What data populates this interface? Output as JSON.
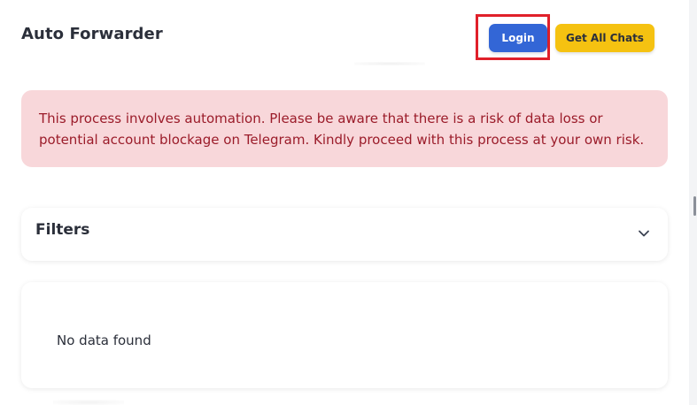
{
  "header": {
    "title": "Auto Forwarder",
    "login_label": "Login",
    "get_chats_label": "Get All Chats"
  },
  "alert": {
    "text": "This process involves automation. Please be aware that there is a risk of data loss or potential account blockage on Telegram. Kindly proceed with this process at your own risk."
  },
  "filters": {
    "title": "Filters",
    "icon": "chevron-down-icon"
  },
  "results": {
    "empty_text": "No data found"
  },
  "colors": {
    "login_button": "#3366d6",
    "get_chats_button": "#f5c211",
    "alert_background": "#f8d7da",
    "alert_text": "#9b1c2a",
    "highlight": "#e0202a"
  }
}
